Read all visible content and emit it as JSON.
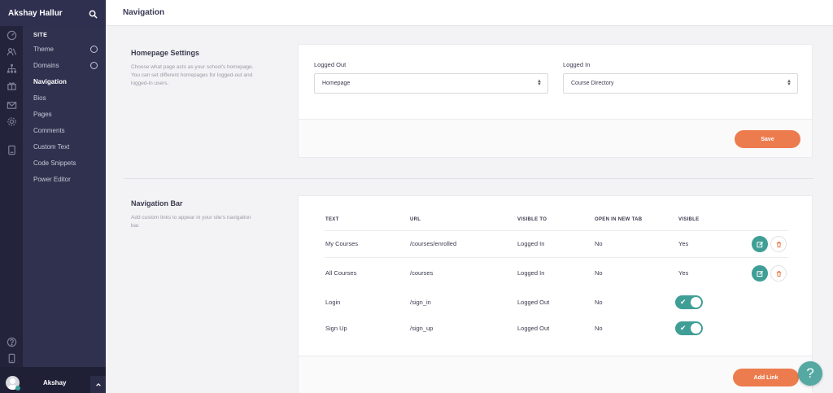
{
  "sidebar": {
    "user_name": "Akshay Hallur",
    "section": "SITE",
    "items": [
      {
        "label": "Theme"
      },
      {
        "label": "Domains"
      },
      {
        "label": "Navigation"
      },
      {
        "label": "Bios"
      },
      {
        "label": "Pages"
      },
      {
        "label": "Comments"
      },
      {
        "label": "Custom Text"
      },
      {
        "label": "Code Snippets"
      },
      {
        "label": "Power Editor"
      }
    ],
    "footer_name": "Akshay"
  },
  "header": {
    "title": "Navigation"
  },
  "homepage_settings": {
    "title": "Homepage Settings",
    "description_lines": [
      "Choose what page acts as your school's homepage.",
      "You can set different homepages for logged-out and",
      "logged-in users."
    ],
    "logged_out_label": "Logged Out",
    "logged_out_value": "Homepage",
    "logged_in_label": "Logged In",
    "logged_in_value": "Course Directory",
    "save_label": "Save"
  },
  "navigation_bar": {
    "title": "Navigation Bar",
    "description_lines": [
      "Add custom links to appear in your site's navigation",
      "bar."
    ],
    "columns": [
      "TEXT",
      "URL",
      "VISIBLE TO",
      "OPEN IN NEW TAB",
      "VISIBLE"
    ],
    "rows": [
      {
        "text": "My Courses",
        "url": "/courses/enrolled",
        "visible_to": "Logged In",
        "new_tab": "No",
        "visible": "Yes"
      },
      {
        "text": "All Courses",
        "url": "/courses",
        "visible_to": "Logged In",
        "new_tab": "No",
        "visible": "Yes"
      },
      {
        "text": "Login",
        "url": "/sign_in",
        "visible_to": "Logged Out",
        "new_tab": "No",
        "visible": "toggle-on"
      },
      {
        "text": "Sign Up",
        "url": "/sign_up",
        "visible_to": "Logged Out",
        "new_tab": "No",
        "visible": "toggle-on"
      }
    ],
    "add_link_label": "Add Link"
  },
  "help": {
    "label": "?"
  },
  "colors": {
    "accent_orange": "#ec7c4e",
    "teal": "#3f9e96",
    "sidebar_bg": "#30314f",
    "rail_bg": "#23243b"
  }
}
